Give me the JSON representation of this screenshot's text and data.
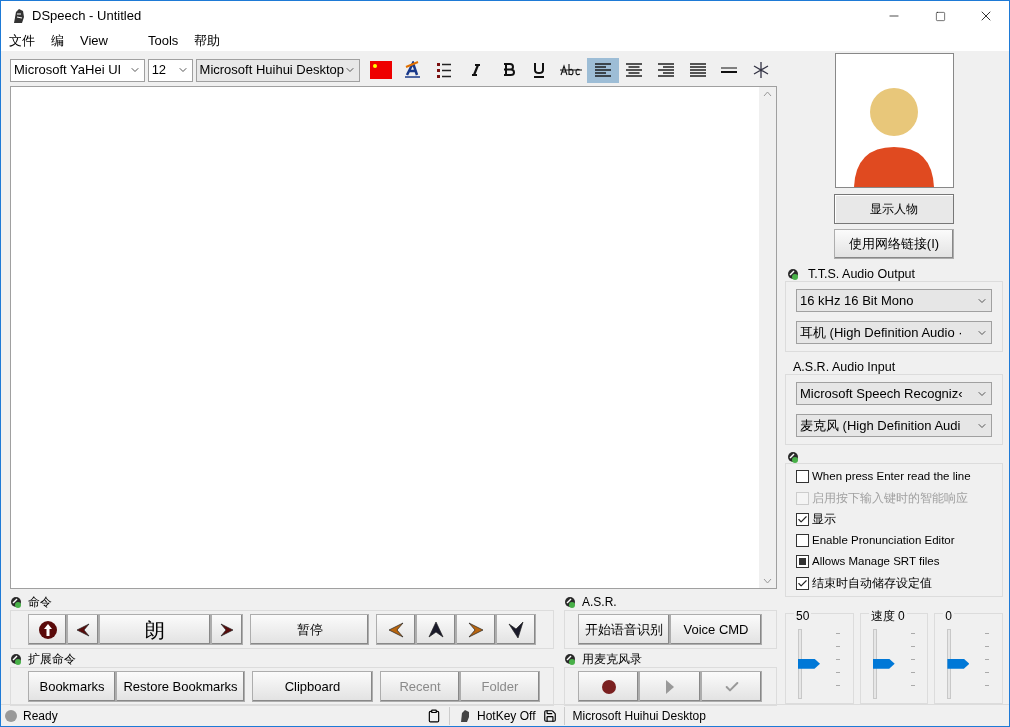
{
  "window": {
    "title": "DSpeech - Untitled"
  },
  "menu": [
    "文件",
    "编",
    "View",
    "Tools",
    "帮助"
  ],
  "toolbar": {
    "font": "Microsoft YaHei UI",
    "size": "12",
    "voice": "Microsoft Huihui Desktop",
    "tools": [
      {
        "kind": "flag",
        "selected": false
      },
      {
        "kind": "color",
        "selected": false
      },
      {
        "kind": "list",
        "selected": false
      },
      {
        "kind": "italic",
        "selected": false
      },
      {
        "kind": "bold",
        "selected": false
      },
      {
        "kind": "underline",
        "selected": false
      },
      {
        "kind": "strike",
        "selected": false
      },
      {
        "kind": "align-left",
        "selected": true
      },
      {
        "kind": "align-center",
        "selected": false
      },
      {
        "kind": "align-right",
        "selected": false
      },
      {
        "kind": "justify",
        "selected": false
      },
      {
        "kind": "rule",
        "selected": false
      },
      {
        "kind": "snow",
        "selected": false
      }
    ]
  },
  "side": {
    "show_character": {
      "label": "显示人物",
      "pressed": true
    },
    "link_button": "使用网络链接(I)",
    "tts": {
      "title": "T.T.S. Audio Output",
      "selects": [
        "16 kHz 16 Bit Mono",
        "耳机 (High Definition Audio ·"
      ]
    },
    "asr": {
      "title": "A.S.R. Audio Input",
      "selects": [
        "Microsoft Speech Recogniz‹",
        "麦克风 (High Definition Audi"
      ]
    },
    "options": [
      {
        "kind": "tick",
        "label": "When press Enter read the line",
        "checked": false,
        "disabled": false
      },
      {
        "kind": "tick",
        "label": "启用按下输入键时的智能响应",
        "checked": false,
        "disabled": true
      },
      {
        "kind": "tick",
        "label": "显示",
        "checked": true,
        "disabled": false
      },
      {
        "kind": "tick",
        "label": "Enable Pronunciation Editor",
        "checked": false,
        "disabled": false
      },
      {
        "kind": "fill",
        "label": "Allows Manage SRT files",
        "checked": true,
        "disabled": false
      },
      {
        "kind": "tick",
        "label": "结束时自动储存设定值",
        "checked": true,
        "disabled": false
      }
    ],
    "sliders": [
      {
        "label": "50",
        "level": 0.5
      },
      {
        "label": "速度 0",
        "level": 0.5
      },
      {
        "label": "0",
        "level": 0.5
      }
    ]
  },
  "commands": {
    "title": "命令",
    "read": "朗",
    "pause": "暂停"
  },
  "ext": {
    "title": "扩展命令",
    "buttons": [
      {
        "label": "Bookmarks",
        "disabled": false
      },
      {
        "label": "Restore Bookmarks",
        "disabled": false
      },
      {
        "label": "Clipboard",
        "disabled": false
      },
      {
        "label": "Recent",
        "disabled": true
      },
      {
        "label": "Folder",
        "disabled": true
      }
    ]
  },
  "asr_group": {
    "title": "A.S.R.",
    "buttons": [
      "开始语音识别",
      "Voice CMD"
    ]
  },
  "record": {
    "title": "用麦克风录"
  },
  "status_bar": {
    "status": "Ready",
    "hotkey": "HotKey Off",
    "voice": "Microsoft Huihui Desktop"
  }
}
